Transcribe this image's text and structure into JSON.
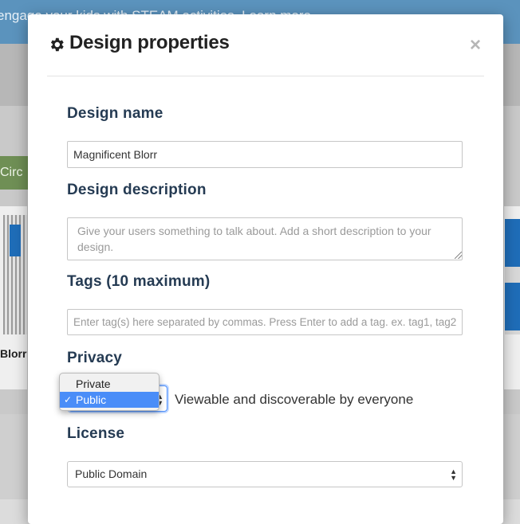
{
  "background": {
    "banner_text": "engage your kids with STEAM activities. Learn more",
    "green_button_text": "Circ",
    "left_card_name": "Blorr"
  },
  "modal": {
    "title": "Design properties",
    "close_label": "×",
    "design_name": {
      "label": "Design name",
      "value": "Magnificent Blorr"
    },
    "design_description": {
      "label": "Design description",
      "placeholder": "Give your users something to talk about. Add a short description to your design."
    },
    "tags": {
      "label": "Tags (10 maximum)",
      "placeholder": "Enter tag(s) here separated by commas. Press Enter to add a tag. ex. tag1, tag2"
    },
    "privacy": {
      "label": "Privacy",
      "options": [
        "Private",
        "Public"
      ],
      "selected": "Public",
      "description": "Viewable and discoverable by everyone"
    },
    "license": {
      "label": "License",
      "value": "Public Domain"
    }
  },
  "colors": {
    "label_text": "#253b53",
    "selected_option": "#4a8df8",
    "focus_ring": "#4d90fe"
  }
}
